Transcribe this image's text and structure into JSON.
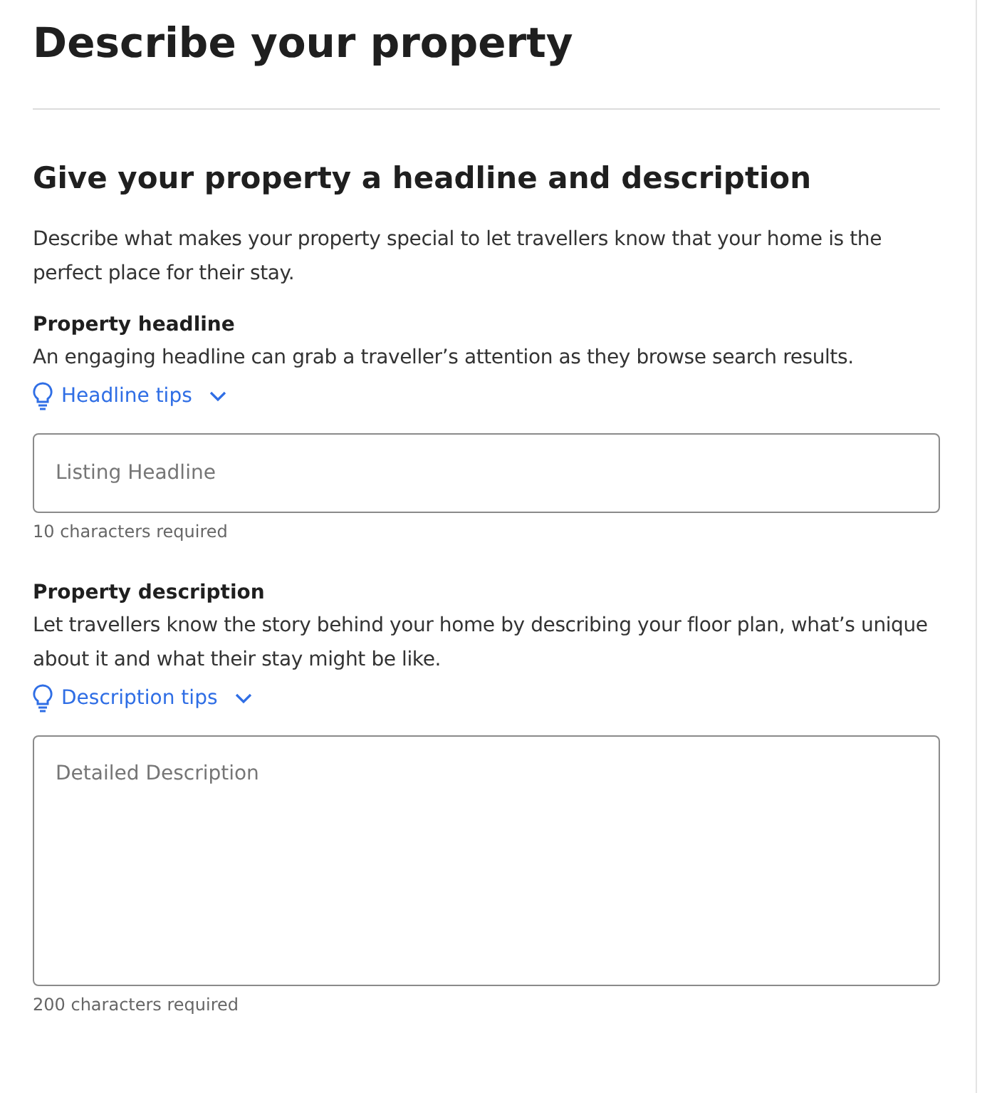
{
  "page_title": "Describe your property",
  "section": {
    "heading": "Give your property a headline and description",
    "intro": "Describe what makes your property special to let travellers know that your home is the perfect place for their stay."
  },
  "fields": [
    {
      "kind": "input",
      "label": "Property headline",
      "help": "An engaging headline can grab a traveller’s attention as they browse search results.",
      "tips": {
        "label": "Headline tips",
        "expanded": false
      },
      "placeholder": "Listing Headline",
      "requirement": "10 characters required"
    },
    {
      "kind": "textarea",
      "label": "Property description",
      "help": "Let travellers know the story behind your home by describing your floor plan, what’s unique about it and what their stay might be like.",
      "tips": {
        "label": "Description tips",
        "expanded": false
      },
      "placeholder": "Detailed Description",
      "requirement": "200 characters required"
    }
  ]
}
